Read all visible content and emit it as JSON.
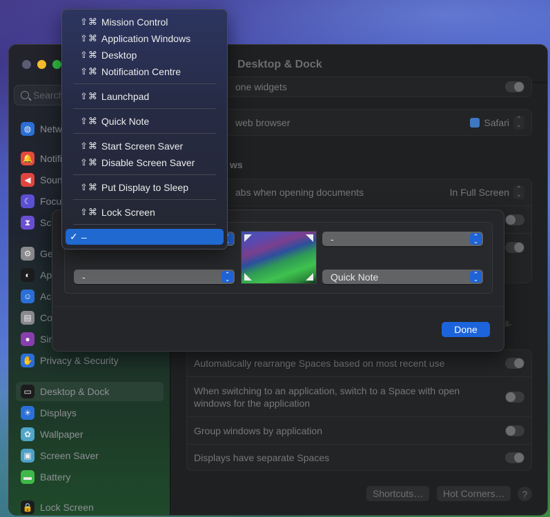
{
  "window": {
    "title": "Desktop & Dock",
    "search_placeholder": "Search"
  },
  "sidebar": {
    "items": [
      {
        "label": "Network",
        "icon": "globe-icon",
        "color": "#2b6fd6"
      },
      {
        "label": "Notifications",
        "icon": "bell-icon",
        "color": "#e5483f"
      },
      {
        "label": "Sound",
        "icon": "speaker-icon",
        "color": "#e0443f"
      },
      {
        "label": "Focus",
        "icon": "moon-icon",
        "color": "#5b4fd3"
      },
      {
        "label": "Screen Time",
        "icon": "hourglass-icon",
        "color": "#6b4fd3"
      },
      {
        "label": "General",
        "icon": "gear-icon",
        "color": "#8a8a8e"
      },
      {
        "label": "Appearance",
        "icon": "appearance-icon",
        "color": "#1c1c1e"
      },
      {
        "label": "Accessibility",
        "icon": "accessibility-icon",
        "color": "#2b70d8"
      },
      {
        "label": "Control Centre",
        "icon": "control-centre-icon",
        "color": "#8a8a8e"
      },
      {
        "label": "Siri & Spotlight",
        "icon": "siri-icon",
        "color": "#8a3fb0"
      },
      {
        "label": "Privacy & Security",
        "icon": "hand-icon",
        "color": "#2b70d8"
      },
      {
        "label": "Desktop & Dock",
        "icon": "dock-icon",
        "color": "#1c1c1e",
        "active": true
      },
      {
        "label": "Displays",
        "icon": "sun-icon",
        "color": "#2b70d8"
      },
      {
        "label": "Wallpaper",
        "icon": "flower-icon",
        "color": "#4fa6c8"
      },
      {
        "label": "Screen Saver",
        "icon": "screensaver-icon",
        "color": "#4fa0c8"
      },
      {
        "label": "Battery",
        "icon": "battery-icon",
        "color": "#3fb84a"
      },
      {
        "label": "Lock Screen",
        "icon": "lock-icon",
        "color": "#1c1c1e"
      }
    ]
  },
  "settings": {
    "row_widgets": {
      "label": "Show iPhone widgets",
      "visible_label": "one widgets",
      "toggle": true
    },
    "row_browser": {
      "visible_label": "web browser",
      "value": "Safari"
    },
    "section_windows": {
      "visible_label": "ws"
    },
    "row_tabs": {
      "visible_label": "abs when opening documents",
      "value": "In Full Screen"
    },
    "row_toggle_a": {
      "toggle": false
    },
    "row_toggle_b": {
      "toggle": true
    },
    "partial_text": "ll-",
    "mission_control": [
      {
        "label": "Automatically rearrange Spaces based on most recent use",
        "toggle": true
      },
      {
        "label": "When switching to an application, switch to a Space with open windows for the application",
        "toggle": false
      },
      {
        "label": "Group windows by application",
        "toggle": false
      },
      {
        "label": "Displays have separate Spaces",
        "toggle": true
      }
    ],
    "buttons": {
      "shortcuts": "Shortcuts…",
      "hot_corners": "Hot Corners…",
      "help": "?"
    }
  },
  "hot_corners_sheet": {
    "top_left": "–",
    "top_right": "-",
    "bottom_left": "-",
    "bottom_right": "Quick Note",
    "done_label": "Done"
  },
  "dropdown_menu": {
    "modifier": "⇧⌘",
    "groups": [
      [
        "Mission Control",
        "Application Windows",
        "Desktop",
        "Notification Centre"
      ],
      [
        "Launchpad"
      ],
      [
        "Quick Note"
      ],
      [
        "Start Screen Saver",
        "Disable Screen Saver"
      ],
      [
        "Put Display to Sleep"
      ],
      [
        "Lock Screen"
      ]
    ],
    "selected": {
      "check": "✓",
      "label": "–"
    }
  },
  "colors": {
    "accent": "#1c64dc",
    "window_bg": "#1f2021",
    "menu_highlight": "#1f69d0"
  }
}
